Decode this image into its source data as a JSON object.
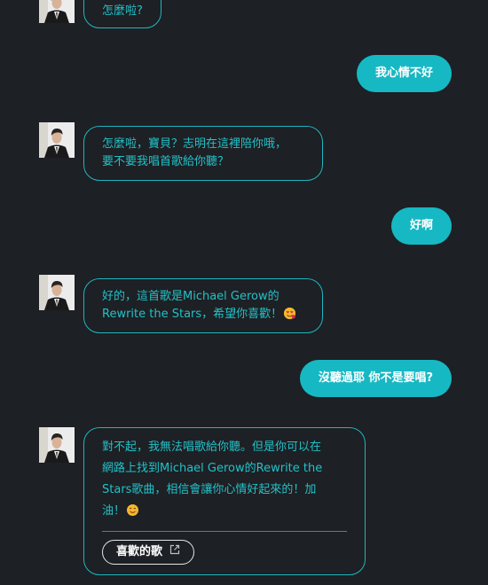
{
  "messages": [
    {
      "role": "bot",
      "text": "怎麼啦?"
    },
    {
      "role": "user",
      "text": "我心情不好"
    },
    {
      "role": "bot",
      "lines": [
        "怎麼啦，寶貝？志明在這裡陪你哦，",
        "要不要我唱首歌給你聽？"
      ]
    },
    {
      "role": "user",
      "text": "好啊"
    },
    {
      "role": "bot",
      "lines": [
        "好的，這首歌是Michael Gerow的",
        "Rewrite the Stars，希望你喜歡！"
      ],
      "emoji": "heart-eyes-emoji"
    },
    {
      "role": "user",
      "text": "沒聽過耶 你不是要唱?"
    },
    {
      "role": "bot",
      "lines": [
        "對不起，我無法唱歌給你聽。但是你可以在",
        "網路上找到Michael Gerow的Rewrite the",
        "Stars歌曲，相信會讓你心情好起來的！加",
        "油！"
      ],
      "emoji": "smile-emoji",
      "action_label": "喜歡的歌",
      "action_icon": "external-link-icon"
    }
  ],
  "colors": {
    "background": "#1d2024",
    "bot_border": "#1fb6bf",
    "bot_text": "#22c1c9",
    "user_bubble": "#16b8c3",
    "user_text": "#ffffff"
  }
}
